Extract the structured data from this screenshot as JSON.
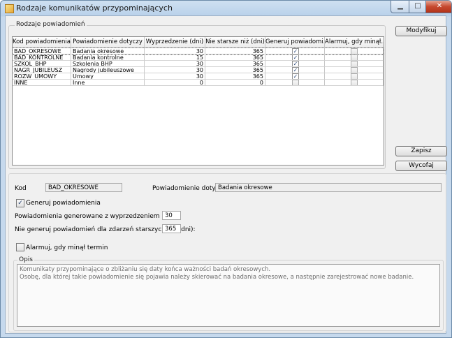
{
  "window": {
    "title": "Rodzaje komunikatów przypominających"
  },
  "controls": {
    "minimize": "▁",
    "maximize": "□",
    "close": "✕"
  },
  "group_list": {
    "title": "Rodzaje powiadomień"
  },
  "table": {
    "headers": [
      "Kod powiadomienia",
      "Powiadomienie dotyczy",
      "Wyprzedzenie (dni)",
      "Nie starsze niż (dni)",
      "Generuj powiadomi...",
      "Alarmuj, gdy minął..."
    ],
    "rows": [
      {
        "code": "BAD_OKRESOWE",
        "subject": "Badania okresowe",
        "advance": "30",
        "max_age": "365",
        "generate": true,
        "alarm": false
      },
      {
        "code": "BAD_KONTROLNE",
        "subject": "Badania kontrolne",
        "advance": "15",
        "max_age": "365",
        "generate": true,
        "alarm": false
      },
      {
        "code": "SZKOL_BHP",
        "subject": "Szkolenia BHP",
        "advance": "30",
        "max_age": "365",
        "generate": true,
        "alarm": false
      },
      {
        "code": "NAGR_JUBILEUSZ",
        "subject": "Nagrody jubileuszowe",
        "advance": "30",
        "max_age": "365",
        "generate": true,
        "alarm": false
      },
      {
        "code": "ROZW_UMOWY",
        "subject": "Umowy",
        "advance": "30",
        "max_age": "365",
        "generate": true,
        "alarm": false
      },
      {
        "code": "INNE",
        "subject": "Inne",
        "advance": "0",
        "max_age": "0",
        "generate": false,
        "alarm": false
      }
    ],
    "selected_row": 0
  },
  "buttons": {
    "modify": "Modyfikuj",
    "save": "Zapisz",
    "cancel": "Wycofaj"
  },
  "form": {
    "code_label": "Kod",
    "code_value": "BAD_OKRESOWE",
    "subject_label": "Powiadomienie dotyczy",
    "subject_value": "Badania okresowe",
    "generate_label": "Generuj powiadomienia",
    "generate_checked": true,
    "advance_label": "Powiadomienia generowane z wyprzedzeniem (dni):",
    "advance_value": "30",
    "max_age_label": "Nie generuj powiadomień dla zdarzeń starszych niż (dni):",
    "max_age_value": "365",
    "alarm_label": "Alarmuj, gdy minął termin",
    "alarm_checked": false,
    "desc_title": "Opis",
    "desc_line1": "Komunikaty przypominające o zbliżaniu się daty końca ważności badań okresowych.",
    "desc_line2": "Osobę, dla której takie powiadomienie się pojawia należy skierować na badania okresowe, a następnie zarejestrować nowe badanie."
  },
  "icons": {
    "check": "✓"
  }
}
